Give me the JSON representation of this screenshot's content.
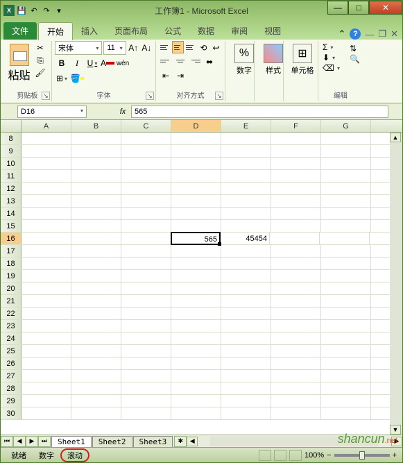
{
  "title": "工作簿1 - Microsoft Excel",
  "tabs": {
    "file": "文件",
    "home": "开始",
    "insert": "插入",
    "layout": "页面布局",
    "formulas": "公式",
    "data": "数据",
    "review": "审阅",
    "view": "视图"
  },
  "ribbon": {
    "clipboard": {
      "paste": "粘贴",
      "label": "剪贴板"
    },
    "font": {
      "name": "宋体",
      "size": "11",
      "label": "字体"
    },
    "align": {
      "label": "对齐方式"
    },
    "number": {
      "label": "数字",
      "pct": "%"
    },
    "styles": {
      "label": "样式"
    },
    "cells": {
      "label": "单元格"
    },
    "editing": {
      "label": "编辑"
    }
  },
  "namebox": "D16",
  "fx": "fx",
  "formula_value": "565",
  "columns": [
    "A",
    "B",
    "C",
    "D",
    "E",
    "F",
    "G"
  ],
  "rows_start": 8,
  "rows_end": 30,
  "active": {
    "row": 16,
    "col": "D"
  },
  "cells": {
    "D16": "565",
    "E16": "45454"
  },
  "sheets": [
    "Sheet1",
    "Sheet2",
    "Sheet3"
  ],
  "status": {
    "ready": "就绪",
    "num": "数字",
    "scroll": "滚动",
    "zoom": "100%"
  },
  "watermark": "shancun",
  "watermark_suffix": ".net"
}
